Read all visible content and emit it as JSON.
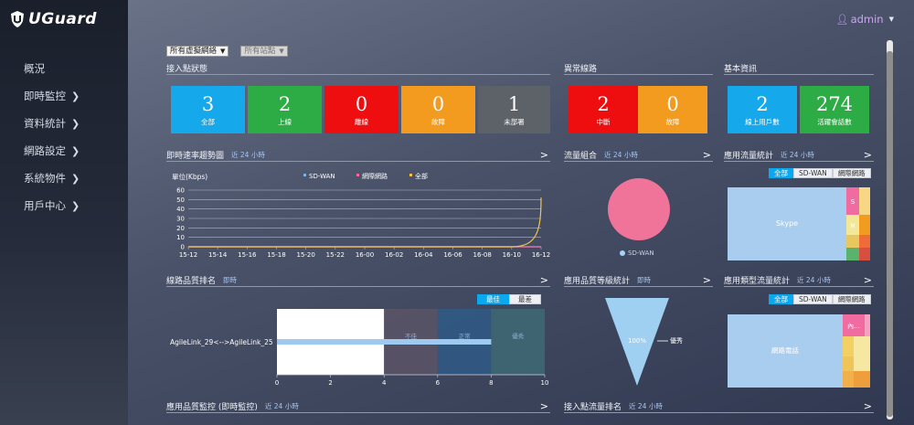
{
  "brand": {
    "name": "UGuard"
  },
  "user": {
    "name": "admin"
  },
  "sidebar": {
    "items": [
      {
        "label": "概況",
        "has_children": false
      },
      {
        "label": "即時監控",
        "has_children": true
      },
      {
        "label": "資料統計",
        "has_children": true
      },
      {
        "label": "網路設定",
        "has_children": true
      },
      {
        "label": "系統物件",
        "has_children": true
      },
      {
        "label": "用戶中心",
        "has_children": true
      }
    ]
  },
  "filters": {
    "network": "所有虛擬網絡",
    "site": "所有站點"
  },
  "access_status": {
    "title": "接入點狀態",
    "tiles": [
      {
        "value": "3",
        "label": "全部",
        "color": "#15a9ec"
      },
      {
        "value": "2",
        "label": "上線",
        "color": "#2dab45"
      },
      {
        "value": "0",
        "label": "離線",
        "color": "#ee0d0f"
      },
      {
        "value": "0",
        "label": "故障",
        "color": "#f39b1f"
      },
      {
        "value": "1",
        "label": "未部署",
        "color": "#5d6269"
      }
    ]
  },
  "abnormal_lines": {
    "title": "異常線路",
    "tiles": [
      {
        "value": "2",
        "label": "中斷",
        "color": "#ee0d0f"
      },
      {
        "value": "0",
        "label": "故障",
        "color": "#f39b1f"
      }
    ]
  },
  "basic_info": {
    "title": "基本資訊",
    "tiles": [
      {
        "value": "2",
        "label": "線上用戶數",
        "color": "#15a9ec"
      },
      {
        "value": "274",
        "label": "活躍會話數",
        "color": "#2dab45"
      }
    ]
  },
  "sections": {
    "rate_trend": {
      "title": "即時速率趨勢圖",
      "sub": "近 24 小時"
    },
    "flow_mix": {
      "title": "流量組合",
      "sub": "近 24 小時"
    },
    "app_flow": {
      "title": "應用流量統計",
      "sub": "近 24 小時"
    },
    "line_rank": {
      "title": "線路品質排名",
      "sub": "即時"
    },
    "app_grade": {
      "title": "應用品質等級統計",
      "sub": "即時"
    },
    "app_type_flow": {
      "title": "應用類型流量統計",
      "sub": "近 24 小時"
    },
    "app_quality": {
      "title": "應用品質監控 (即時監控)",
      "sub": "近 24 小時"
    },
    "ap_flow_rank": {
      "title": "接入點流量排名",
      "sub": "近 24 小時"
    }
  },
  "tabs": {
    "app_flow": [
      "全部",
      "SD-WAN",
      "網際網路"
    ],
    "app_type_flow": [
      "全部",
      "SD-WAN",
      "網際網路"
    ],
    "line_rank": [
      "最佳",
      "最差"
    ]
  },
  "chart_data": [
    {
      "type": "line",
      "title": "即時速率趨勢圖",
      "ylabel": "單位(Kbps)",
      "ylim": [
        0,
        60
      ],
      "yticks": [
        0,
        10,
        20,
        30,
        40,
        50,
        60
      ],
      "x": [
        "15-12",
        "15-14",
        "15-16",
        "15-18",
        "15-20",
        "15-22",
        "16-00",
        "16-02",
        "16-04",
        "16-06",
        "16-08",
        "16-10",
        "16-12"
      ],
      "series": [
        {
          "name": "SD-WAN",
          "color": "#7fb3e8",
          "values": [
            0,
            0,
            0,
            0,
            0,
            0,
            0,
            0,
            0,
            0,
            0,
            0,
            0
          ]
        },
        {
          "name": "網際網路",
          "color": "#f06ca0",
          "values": [
            0,
            0,
            0,
            0,
            0,
            0,
            0,
            0,
            0,
            0,
            0,
            0,
            0
          ]
        },
        {
          "name": "全部",
          "color": "#f2c44f",
          "values": [
            0,
            0,
            0,
            0,
            0,
            0,
            0,
            0,
            0,
            0,
            0,
            0,
            52
          ]
        }
      ],
      "legend": "top",
      "grid": true
    },
    {
      "type": "pie",
      "title": "流量組合",
      "slices": [
        {
          "label": "SD-WAN",
          "value": 100,
          "color": "#f07399"
        }
      ],
      "legend": "bottom"
    },
    {
      "type": "bar",
      "title": "線路品質排名",
      "categories": [
        "AgileLink_29<-->AgileLink_25"
      ],
      "values": [
        8
      ],
      "xlim": [
        0,
        10
      ],
      "xticks": [
        0,
        2,
        4,
        6,
        8,
        10
      ],
      "bands": [
        {
          "from": 0,
          "to": 4,
          "label": "",
          "color": "#ffffff"
        },
        {
          "from": 4,
          "to": 6,
          "label": "不佳",
          "color": "#5a5466"
        },
        {
          "from": 6,
          "to": 8,
          "label": "正常",
          "color": "#2f5a86"
        },
        {
          "from": 8,
          "to": 10,
          "label": "優秀",
          "color": "#3f6a74"
        }
      ],
      "grid": false
    },
    {
      "type": "area",
      "title": "應用品質等級統計",
      "funnel": [
        {
          "label": "優秀",
          "percent": 100,
          "color": "#9fd0f2"
        }
      ]
    }
  ],
  "treemaps": {
    "app_flow": [
      {
        "label": "Skype",
        "color": "#a9cdee"
      },
      {
        "label": "S",
        "color": "#f06ca0"
      },
      {
        "label": "M",
        "color": "#f3e89a"
      }
    ],
    "app_type": [
      {
        "label": "網路電話",
        "color": "#a9cdee"
      },
      {
        "label": "內...",
        "color": "#f06ca0"
      }
    ]
  }
}
